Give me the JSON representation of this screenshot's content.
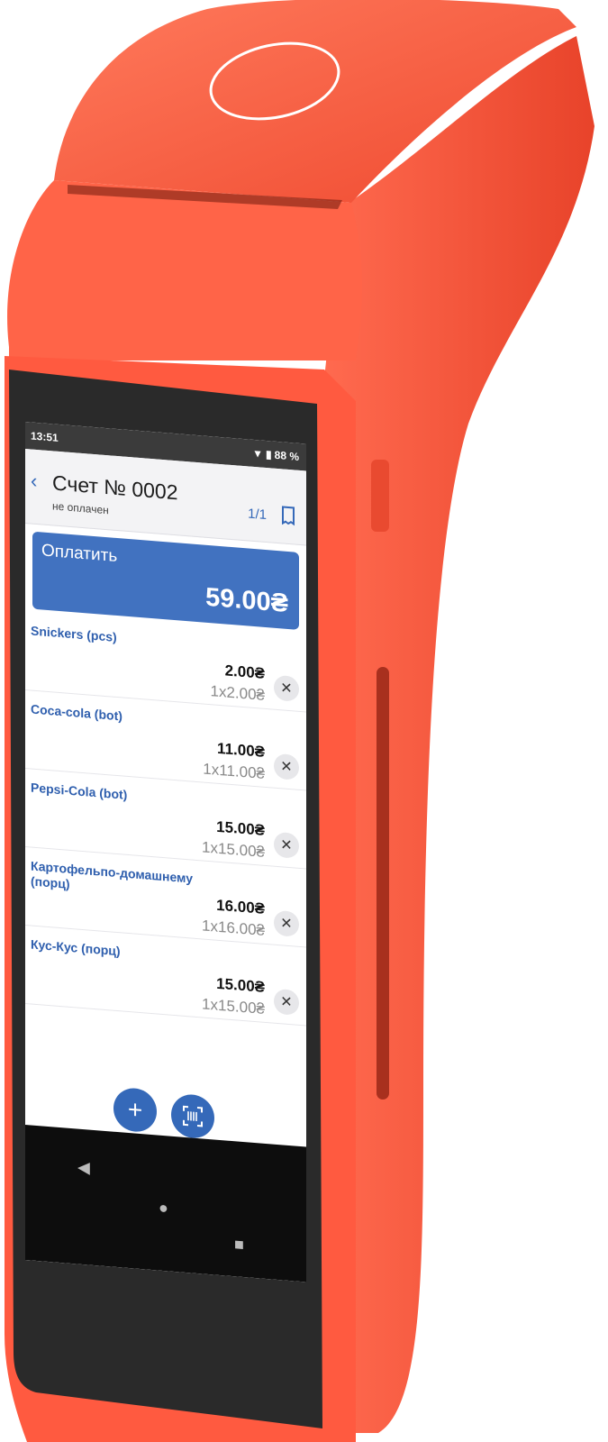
{
  "status": {
    "time": "13:51",
    "battery": "88 %"
  },
  "header": {
    "back_icon": "back-chevron-icon",
    "title": "Счет № 0002",
    "subtitle": "не оплачен",
    "page_counter": "1/1",
    "receipt_icon": "receipt-icon"
  },
  "pay": {
    "label": "Оплатить",
    "total": "59.00₴"
  },
  "items": [
    {
      "name": "Snickers (pcs)",
      "price": "2.00₴",
      "qty": "1x2.00₴"
    },
    {
      "name": "Coca-cola (bot)",
      "price": "11.00₴",
      "qty": "1x11.00₴"
    },
    {
      "name": "Pepsi-Cola (bot)",
      "price": "15.00₴",
      "qty": "1x15.00₴"
    },
    {
      "name": "Картофельпо-домашнему (порц)",
      "price": "16.00₴",
      "qty": "1x16.00₴"
    },
    {
      "name": "Кус-Кус (порц)",
      "price": "15.00₴",
      "qty": "1x15.00₴"
    }
  ],
  "remove_symbol": "✕",
  "fabs": {
    "add_symbol": "+",
    "scan_icon": "barcode-scan-icon"
  },
  "colors": {
    "device": "#ff5a40",
    "accent": "#3569b9",
    "pay_panel": "#4172c0"
  }
}
